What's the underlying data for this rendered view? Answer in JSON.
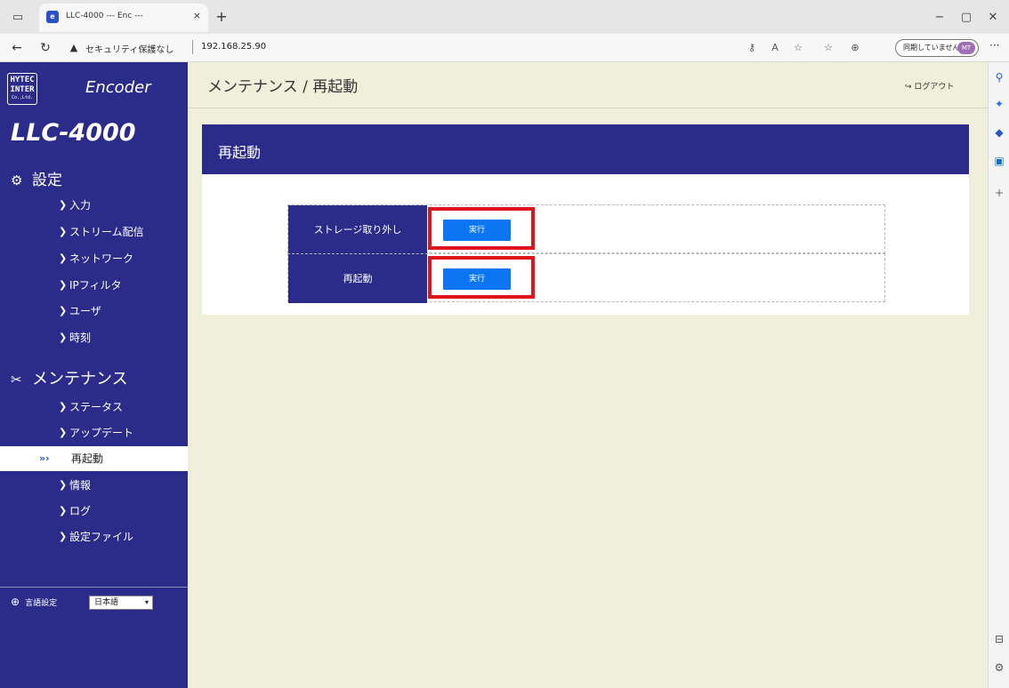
{
  "browser": {
    "tab_title": "LLC-4000 --- Enc ---",
    "tab_close": "×",
    "new_tab": "+",
    "security_warning": "セキュリティ保護なし",
    "url": "192.168.25.90",
    "sync_label": "同期していません",
    "profile_initials": "MT",
    "window_controls": {
      "minimize": "−",
      "restore": "▢",
      "close": "✕"
    }
  },
  "sidebar": {
    "logo_lines": [
      "HYTEC",
      "INTER",
      "Co.,Ltd."
    ],
    "encoder_label": "Encoder",
    "model": "LLC-4000",
    "settings_heading": "設定",
    "settings_items": [
      {
        "label": "入力"
      },
      {
        "label": "ストリーム配信"
      },
      {
        "label": "ネットワーク"
      },
      {
        "label": "IPフィルタ"
      },
      {
        "label": "ユーザ"
      },
      {
        "label": "時刻"
      }
    ],
    "maintenance_heading": "メンテナンス",
    "maintenance_items": [
      {
        "label": "ステータス"
      },
      {
        "label": "アップデート"
      },
      {
        "label": "再起動",
        "active": true
      },
      {
        "label": "情報"
      },
      {
        "label": "ログ"
      },
      {
        "label": "設定ファイル"
      }
    ],
    "language_label": "言語設定",
    "language_value": "日本語"
  },
  "main": {
    "breadcrumb": "メンテナンス / 再起動",
    "logout_label": "ログアウト",
    "panel_title": "再起動",
    "rows": [
      {
        "label": "ストレージ取り外し",
        "button": "実行"
      },
      {
        "label": "再起動",
        "button": "実行"
      }
    ]
  },
  "colors": {
    "sidebar_bg": "#2b2c8a",
    "main_bg": "#efefdc",
    "button_blue": "#0a76f2",
    "highlight_red": "#e2141b"
  }
}
